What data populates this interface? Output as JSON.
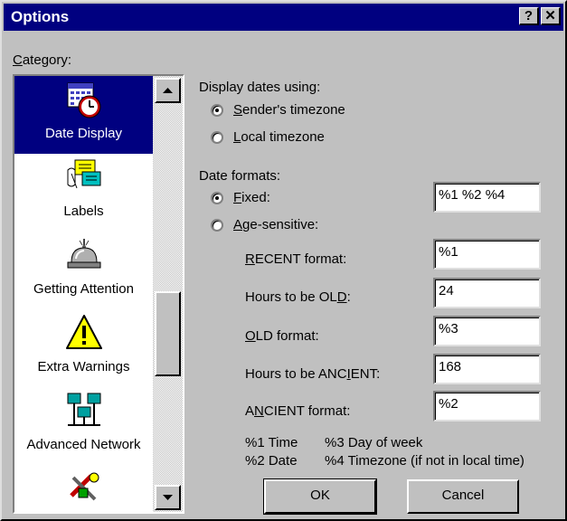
{
  "window": {
    "title": "Options",
    "help_glyph": "?",
    "close_glyph": "✕"
  },
  "category": {
    "label_mnemonic": "C",
    "label_rest": "ategory:",
    "items": [
      {
        "label": "Date Display",
        "icon": "calendar-clock-icon",
        "selected": true
      },
      {
        "label": "Labels",
        "icon": "labels-cards-icon",
        "selected": false
      },
      {
        "label": "Getting Attention",
        "icon": "service-bell-icon",
        "selected": false
      },
      {
        "label": "Extra Warnings",
        "icon": "warning-icon",
        "selected": false
      },
      {
        "label": "Advanced Network",
        "icon": "network-computers-icon",
        "selected": false
      },
      {
        "label": "",
        "icon": "tools-icon",
        "selected": false
      }
    ]
  },
  "display_dates": {
    "heading": "Display dates using:",
    "sender_mnemonic": "S",
    "sender_rest": "ender's timezone",
    "local_mnemonic": "L",
    "local_rest": "ocal timezone",
    "selected": "sender"
  },
  "date_formats": {
    "heading": "Date formats:",
    "fixed_mnemonic": "F",
    "fixed_rest": "ixed:",
    "fixed_value": "%1 %2 %4",
    "age_mnemonic": "A",
    "age_rest": "ge-sensitive:",
    "selected": "fixed"
  },
  "fields": {
    "recent": {
      "mnemonic": "R",
      "rest": "ECENT format:",
      "value": "%1"
    },
    "hours_old": {
      "pre": "Hours to be OL",
      "mnemonic": "D",
      "post": ":",
      "value": "24"
    },
    "old": {
      "mnemonic": "O",
      "rest": "LD format:",
      "value": "%3"
    },
    "hours_ancient": {
      "pre": "Hours to be ANC",
      "mnemonic": "I",
      "post": "ENT:",
      "value": "168"
    },
    "ancient": {
      "pre": "A",
      "mnemonic": "N",
      "post": "CIENT format:",
      "value": "%2"
    }
  },
  "legend": {
    "l1": "%1 Time",
    "l3": "%3 Day of week",
    "l2": "%2 Date",
    "l4": "%4 Timezone (if not in local time)"
  },
  "buttons": {
    "ok": "OK",
    "cancel": "Cancel"
  }
}
